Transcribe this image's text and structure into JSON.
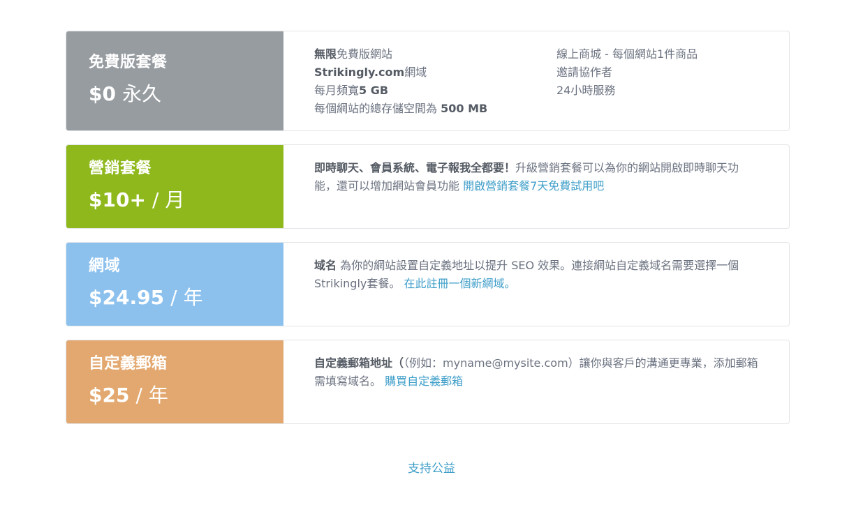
{
  "colors": {
    "free": "#979ca1",
    "marketing": "#8eb81b",
    "domain": "#8cc1ee",
    "email": "#e3a86f",
    "link": "#3f9ec9"
  },
  "plans": {
    "free": {
      "name": "免費版套餐",
      "price": "$0",
      "period": "永久",
      "features_left": [
        {
          "bold": "無限",
          "text": "免費版網站",
          "bold_after": ""
        },
        {
          "bold": "Strikingly.com",
          "text": "網域",
          "bold_after": ""
        },
        {
          "bold": "",
          "text": "每月頻寬",
          "bold_after": "5 GB"
        },
        {
          "bold": "",
          "text": "每個網站的總存儲空間為 ",
          "bold_after": "500 MB"
        }
      ],
      "features_right": [
        "線上商城 - 每個網站1件商品",
        "邀請協作者",
        "24小時服務"
      ]
    },
    "marketing": {
      "name": "營銷套餐",
      "price": "$10+",
      "period": "/ 月",
      "desc_bold": "即時聊天、會員系統、電子報我全都要！",
      "desc_text": "升級營銷套餐可以為你的網站開啟即時聊天功能，還可以增加網站會員功能",
      "link": "開啟營銷套餐7天免費試用吧"
    },
    "domain": {
      "name": "網域",
      "price": "$24.95",
      "period": "/ 年",
      "desc_bold": "域名",
      "desc_text": " 為你的網站設置自定義地址以提升 SEO 效果。連接網站自定義域名需要選擇一個Strikingly套餐。",
      "link": "在此註冊一個新網域。"
    },
    "email": {
      "name": "自定義郵箱",
      "price": "$25",
      "period": "/ 年",
      "desc_bold": "自定義郵箱地址（",
      "desc_text": "（例如：myname@mysite.com）讓你與客戶的溝通更專業，添加郵箱需填寫域名。",
      "link": "購買自定義郵箱"
    }
  },
  "footer": {
    "link": "支持公益"
  }
}
